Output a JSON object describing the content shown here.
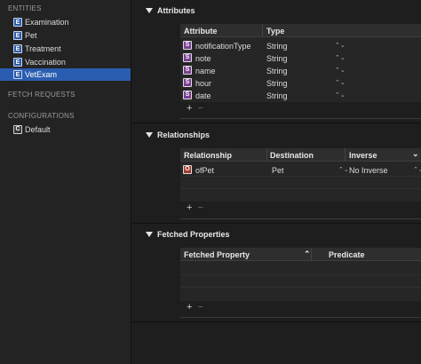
{
  "sidebar": {
    "entities_header": "ENTITIES",
    "entities": [
      {
        "badge": "E",
        "label": "Examination"
      },
      {
        "badge": "E",
        "label": "Pet"
      },
      {
        "badge": "E",
        "label": "Treatment"
      },
      {
        "badge": "E",
        "label": "Vaccination"
      },
      {
        "badge": "E",
        "label": "VetExam",
        "selected": true
      }
    ],
    "fetch_header": "FETCH REQUESTS",
    "config_header": "CONFIGURATIONS",
    "configurations": [
      {
        "badge": "C",
        "label": "Default"
      }
    ]
  },
  "attributes": {
    "title": "Attributes",
    "col_attribute": "Attribute",
    "col_type": "Type",
    "rows": [
      {
        "badge": "S",
        "name": "notificationType",
        "type": "String"
      },
      {
        "badge": "S",
        "name": "note",
        "type": "String"
      },
      {
        "badge": "S",
        "name": "name",
        "type": "String"
      },
      {
        "badge": "S",
        "name": "hour",
        "type": "String"
      },
      {
        "badge": "S",
        "name": "date",
        "type": "String"
      }
    ]
  },
  "relationships": {
    "title": "Relationships",
    "col_relationship": "Relationship",
    "col_destination": "Destination",
    "col_inverse": "Inverse",
    "rows": [
      {
        "badge": "O",
        "name": "ofPet",
        "destination": "Pet",
        "inverse": "No Inverse"
      }
    ]
  },
  "fetched": {
    "title": "Fetched Properties",
    "col_property": "Fetched Property",
    "col_predicate": "Predicate"
  },
  "controls": {
    "add": "+",
    "remove": "−",
    "stepper": "⌃⌄",
    "sort_up": "⌃",
    "chevron": "⌄"
  }
}
